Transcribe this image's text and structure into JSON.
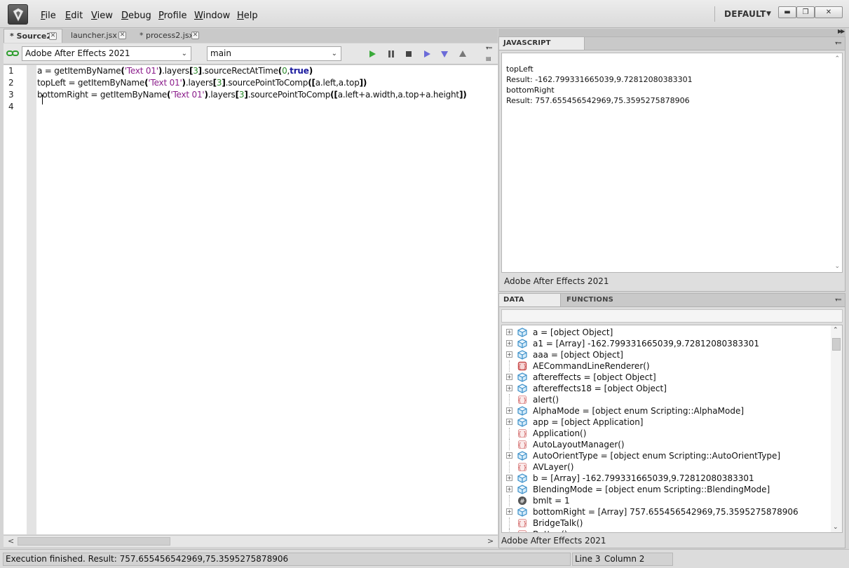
{
  "menu": {
    "items": [
      {
        "pre": "",
        "u": "F",
        "post": "ile"
      },
      {
        "pre": "",
        "u": "E",
        "post": "dit"
      },
      {
        "pre": "",
        "u": "V",
        "post": "iew"
      },
      {
        "pre": "",
        "u": "D",
        "post": "ebug"
      },
      {
        "pre": "",
        "u": "P",
        "post": "rofile"
      },
      {
        "pre": "",
        "u": "W",
        "post": "indow"
      },
      {
        "pre": "",
        "u": "H",
        "post": "elp"
      }
    ],
    "workspace": "DEFAULT"
  },
  "tabs": [
    "* Source2",
    "launcher.jsx",
    "* process2.jsx"
  ],
  "toolbar": {
    "target": "Adobe After Effects 2021",
    "function": "main"
  },
  "editor": {
    "line_numbers": [
      "1",
      "2",
      "3",
      "4"
    ]
  },
  "console": {
    "tab": "JAVASCRIPT CONSOLE",
    "lines": [
      "topLeft",
      "Result: -162.799331665039,9.72812080383301",
      "bottomRight",
      "Result: 757.655456542969,75.3595275878906"
    ],
    "status": "Adobe After Effects 2021"
  },
  "data_browser": {
    "tab": "DATA BROWSER",
    "functions_tab": "FUNCTIONS",
    "rows": [
      {
        "label": "a = [object Object]",
        "kind": "object",
        "expandable": true
      },
      {
        "label": "a1 = [Array] -162.799331665039,9.72812080383301",
        "kind": "object",
        "expandable": true
      },
      {
        "label": "aaa = [object Object]",
        "kind": "object",
        "expandable": true
      },
      {
        "label": "AECommandLineRenderer()",
        "kind": "function-red",
        "expandable": false
      },
      {
        "label": "aftereffects = [object Object]",
        "kind": "object",
        "expandable": true
      },
      {
        "label": "aftereffects18 = [object Object]",
        "kind": "object",
        "expandable": true
      },
      {
        "label": "alert()",
        "kind": "function",
        "expandable": false
      },
      {
        "label": "AlphaMode = [object enum Scripting::AlphaMode]",
        "kind": "object",
        "expandable": true
      },
      {
        "label": "app = [object Application]",
        "kind": "object",
        "expandable": true
      },
      {
        "label": "Application()",
        "kind": "function",
        "expandable": false
      },
      {
        "label": "AutoLayoutManager()",
        "kind": "function",
        "expandable": false
      },
      {
        "label": "AutoOrientType = [object enum Scripting::AutoOrientType]",
        "kind": "object",
        "expandable": true
      },
      {
        "label": "AVLayer()",
        "kind": "function",
        "expandable": false
      },
      {
        "label": "b = [Array] -162.799331665039,9.72812080383301",
        "kind": "object",
        "expandable": true
      },
      {
        "label": "BlendingMode = [object enum Scripting::BlendingMode]",
        "kind": "object",
        "expandable": true
      },
      {
        "label": "bmlt = 1",
        "kind": "number",
        "expandable": false
      },
      {
        "label": "bottomRight = [Array] 757.655456542969,75.3595275878906",
        "kind": "object",
        "expandable": true
      },
      {
        "label": "BridgeTalk()",
        "kind": "function",
        "expandable": false
      },
      {
        "label": "Button()",
        "kind": "function",
        "expandable": false
      }
    ],
    "status": "Adobe After Effects 2021"
  },
  "statusbar": {
    "message": "Execution finished. Result: 757.655456542969,75.3595275878906",
    "line": "Line 3",
    "column": "Column 2"
  },
  "colors": {
    "string": "#8b1d8b",
    "number": "#2a8a2a",
    "keyword": "#1a1a9e",
    "object_icon": "#3a8fc9",
    "function_icon": "#c84a4a"
  }
}
